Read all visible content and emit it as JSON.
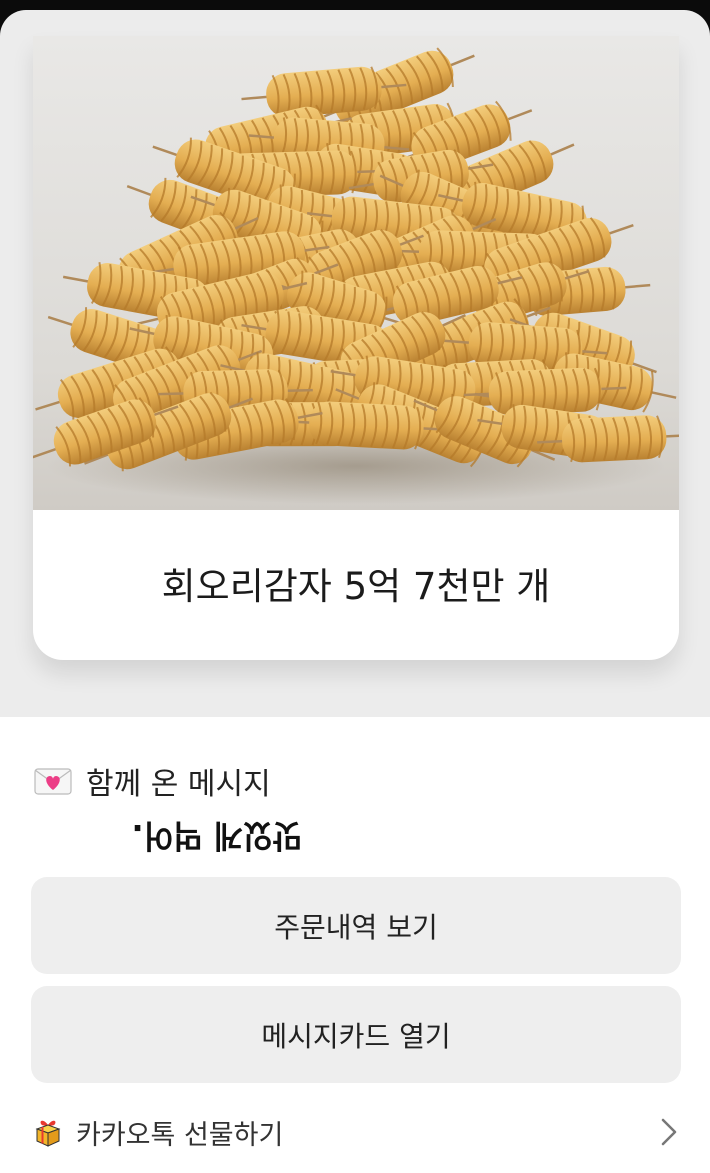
{
  "gift_card": {
    "image_icon": "spiral-potato-skewers-image",
    "title": "회오리감자 5억 7천만 개"
  },
  "message": {
    "icon": "heart-envelope-icon",
    "label": "함께 온 메시지",
    "text": "맛있게 먹어."
  },
  "buttons": {
    "view_orders": "주문내역 보기",
    "open_message_card": "메시지카드 열기"
  },
  "footer": {
    "icon": "gift-box-icon",
    "label": "카카오톡 선물하기",
    "chevron": "chevron-right-icon"
  },
  "colors": {
    "card_bg": "#ececec",
    "button_bg": "#eeeeee",
    "potato": "#e9b85c",
    "potato_dark": "#c38b32"
  }
}
